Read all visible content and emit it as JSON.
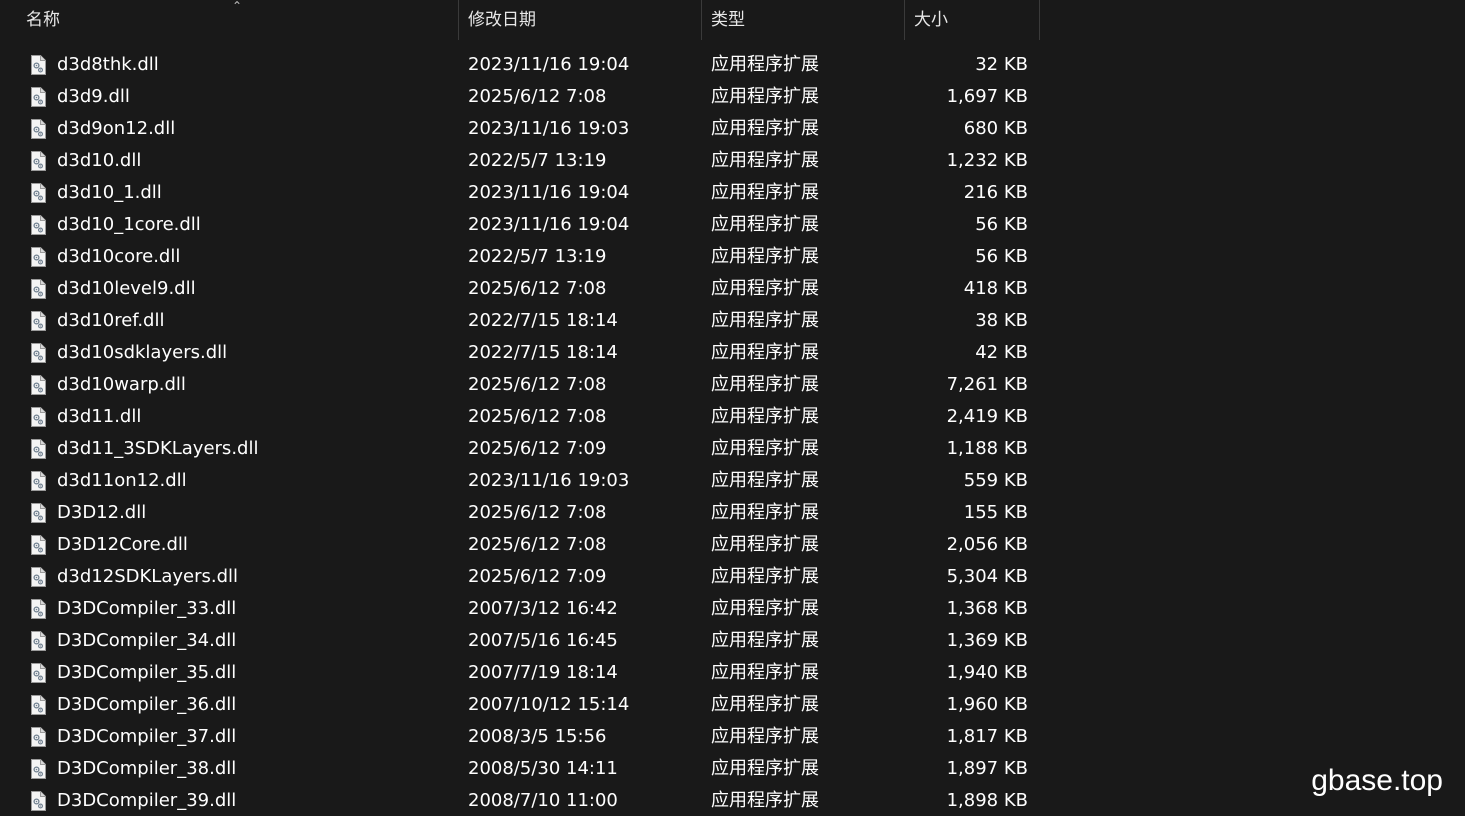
{
  "columns": {
    "name": "名称",
    "date": "修改日期",
    "type": "类型",
    "size": "大小"
  },
  "icons": {
    "file": "dll-file-icon",
    "sort": "sort-ascending-caret"
  },
  "files": [
    {
      "name": "d3d8thk.dll",
      "date": "2023/11/16 19:04",
      "type": "应用程序扩展",
      "size": "32 KB"
    },
    {
      "name": "d3d9.dll",
      "date": "2025/6/12 7:08",
      "type": "应用程序扩展",
      "size": "1,697 KB"
    },
    {
      "name": "d3d9on12.dll",
      "date": "2023/11/16 19:03",
      "type": "应用程序扩展",
      "size": "680 KB"
    },
    {
      "name": "d3d10.dll",
      "date": "2022/5/7 13:19",
      "type": "应用程序扩展",
      "size": "1,232 KB"
    },
    {
      "name": "d3d10_1.dll",
      "date": "2023/11/16 19:04",
      "type": "应用程序扩展",
      "size": "216 KB"
    },
    {
      "name": "d3d10_1core.dll",
      "date": "2023/11/16 19:04",
      "type": "应用程序扩展",
      "size": "56 KB"
    },
    {
      "name": "d3d10core.dll",
      "date": "2022/5/7 13:19",
      "type": "应用程序扩展",
      "size": "56 KB"
    },
    {
      "name": "d3d10level9.dll",
      "date": "2025/6/12 7:08",
      "type": "应用程序扩展",
      "size": "418 KB"
    },
    {
      "name": "d3d10ref.dll",
      "date": "2022/7/15 18:14",
      "type": "应用程序扩展",
      "size": "38 KB"
    },
    {
      "name": "d3d10sdklayers.dll",
      "date": "2022/7/15 18:14",
      "type": "应用程序扩展",
      "size": "42 KB"
    },
    {
      "name": "d3d10warp.dll",
      "date": "2025/6/12 7:08",
      "type": "应用程序扩展",
      "size": "7,261 KB"
    },
    {
      "name": "d3d11.dll",
      "date": "2025/6/12 7:08",
      "type": "应用程序扩展",
      "size": "2,419 KB"
    },
    {
      "name": "d3d11_3SDKLayers.dll",
      "date": "2025/6/12 7:09",
      "type": "应用程序扩展",
      "size": "1,188 KB"
    },
    {
      "name": "d3d11on12.dll",
      "date": "2023/11/16 19:03",
      "type": "应用程序扩展",
      "size": "559 KB"
    },
    {
      "name": "D3D12.dll",
      "date": "2025/6/12 7:08",
      "type": "应用程序扩展",
      "size": "155 KB"
    },
    {
      "name": "D3D12Core.dll",
      "date": "2025/6/12 7:08",
      "type": "应用程序扩展",
      "size": "2,056 KB"
    },
    {
      "name": "d3d12SDKLayers.dll",
      "date": "2025/6/12 7:09",
      "type": "应用程序扩展",
      "size": "5,304 KB"
    },
    {
      "name": "D3DCompiler_33.dll",
      "date": "2007/3/12 16:42",
      "type": "应用程序扩展",
      "size": "1,368 KB"
    },
    {
      "name": "D3DCompiler_34.dll",
      "date": "2007/5/16 16:45",
      "type": "应用程序扩展",
      "size": "1,369 KB"
    },
    {
      "name": "D3DCompiler_35.dll",
      "date": "2007/7/19 18:14",
      "type": "应用程序扩展",
      "size": "1,940 KB"
    },
    {
      "name": "D3DCompiler_36.dll",
      "date": "2007/10/12 15:14",
      "type": "应用程序扩展",
      "size": "1,960 KB"
    },
    {
      "name": "D3DCompiler_37.dll",
      "date": "2008/3/5 15:56",
      "type": "应用程序扩展",
      "size": "1,817 KB"
    },
    {
      "name": "D3DCompiler_38.dll",
      "date": "2008/5/30 14:11",
      "type": "应用程序扩展",
      "size": "1,897 KB"
    },
    {
      "name": "D3DCompiler_39.dll",
      "date": "2008/7/10 11:00",
      "type": "应用程序扩展",
      "size": "1,898 KB"
    }
  ],
  "watermark": "gbase.top"
}
